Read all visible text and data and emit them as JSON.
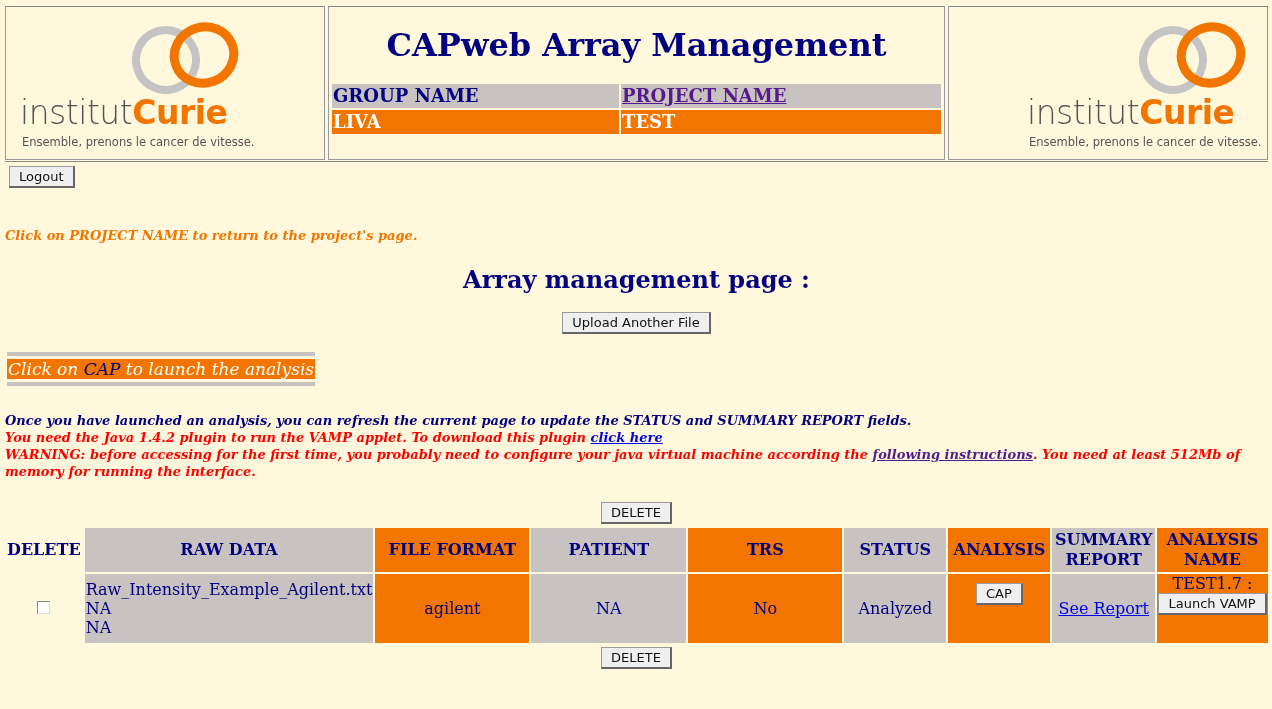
{
  "header": {
    "logos": [
      {
        "wordmark": "institut**Curie**",
        "tagline": "Ensemble, prenons le cancer de vitesse."
      },
      {
        "wordmark": "institut**Curie**",
        "tagline": "Ensemble, prenons le cancer de vitesse."
      }
    ],
    "title": "CAPweb Array Management",
    "info_table": {
      "group_label": "GROUP NAME",
      "project_label": "PROJECT NAME",
      "group_value": "LIVA",
      "project_value": "TEST"
    }
  },
  "logout_button": "Logout",
  "project_hint": "Click on PROJECT NAME to return to the project's page.",
  "page_title": "Array management page :",
  "upload_button": "Upload Another File",
  "banner": "Click on **CAP** to launch the analysis",
  "notes": [
    {
      "kind": "info",
      "text": "Once you have launched an analysis, you can refresh the current page to update the STATUS and SUMMARY REPORT fields."
    },
    {
      "kind": "warning",
      "text": "You need the Java 1.4.2 plugin to run the VAMP applet. To download this plugin ",
      "link": "click here"
    },
    {
      "kind": "warning",
      "text": "WARNING: before accessing for the first time, you probably need to configure your java virtual machine according the ",
      "link": "following instructions",
      "after": ". You need at least 512Mb of memory for running the interface."
    }
  ],
  "delete_buttons": [
    "DELETE",
    "DELETE"
  ],
  "table": {
    "columns": [
      {
        "label": "DELETE"
      },
      {
        "label": "RAW DATA",
        "color": "#c8c3c0"
      },
      {
        "label": "FILE FORMAT",
        "color": "#f27500"
      },
      {
        "label": "PATIENT",
        "color": "#c8c3c0"
      },
      {
        "label": "TRS",
        "color": "#f27500"
      },
      {
        "label": "STATUS",
        "color": "#c8c3c0"
      },
      {
        "label": "ANALYSIS",
        "color": "#f27500"
      },
      {
        "label": "SUMMARY REPORT",
        "color": "#c8c3c0"
      },
      {
        "label": "ANALYSIS NAME",
        "color": "#f27500"
      }
    ],
    "rows": [
      {
        "checked": false,
        "raw_data": [
          "Raw_Intensity_Example_Agilent.txt",
          "NA",
          "NA"
        ],
        "file_format": "agilent",
        "patient": "NA",
        "trs": "No",
        "status": "Analyzed",
        "analysis_button": "CAP",
        "report_link": "See Report",
        "analysis_name": "TEST1.7 :",
        "launch_button": "Launch VAMP"
      }
    ]
  }
}
